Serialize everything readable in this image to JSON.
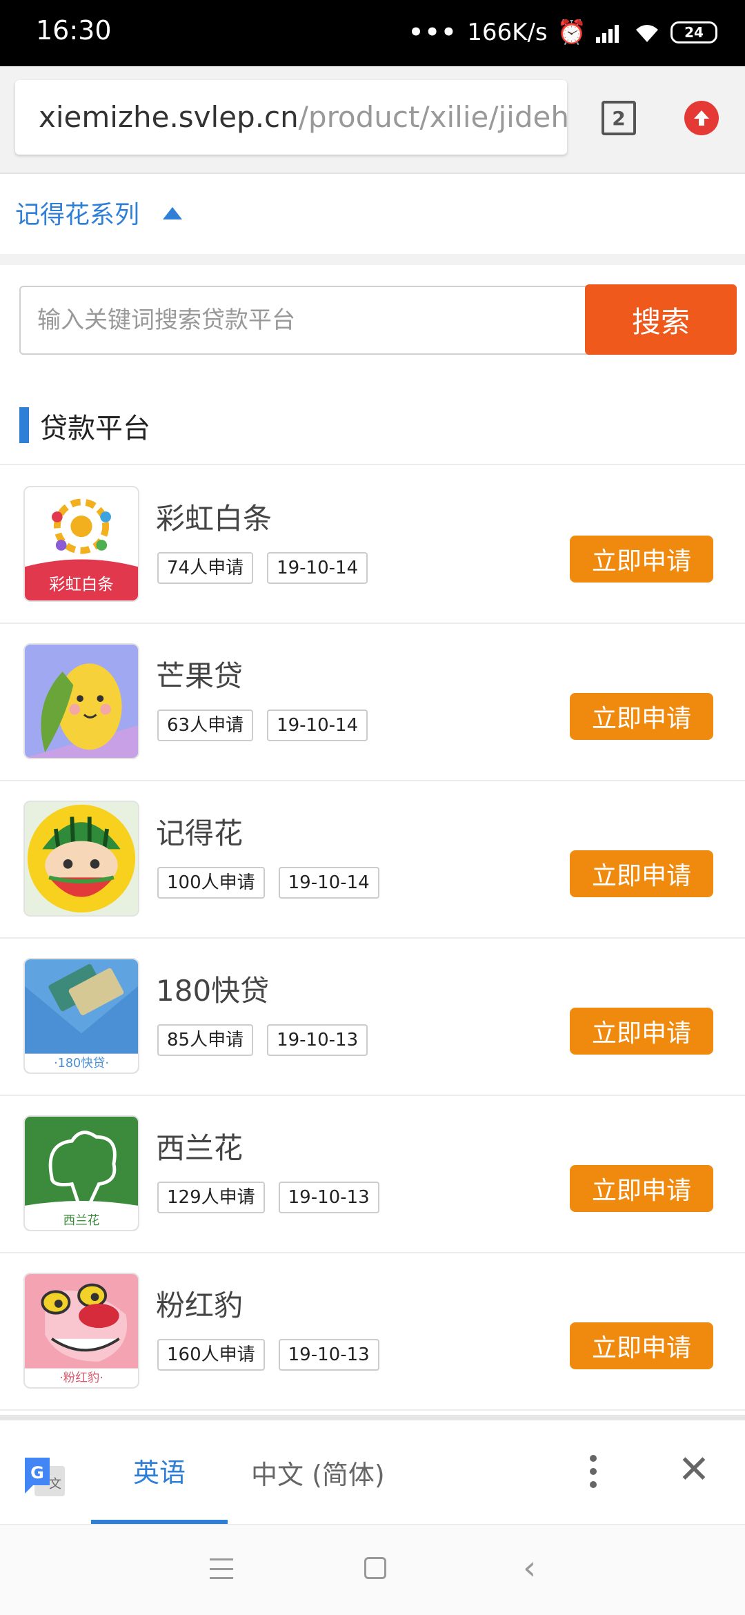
{
  "status_bar": {
    "time": "16:30",
    "network_speed": "166K/s",
    "battery": "24",
    "icons": [
      "more-dots-icon",
      "alarm-icon",
      "signal-icon",
      "wifi-icon",
      "battery-icon"
    ]
  },
  "browser": {
    "url_host": "xiemizhe.svlep.cn",
    "url_path": "/product/xilie/jidehu",
    "tab_count": "2"
  },
  "category": {
    "title": "记得花系列"
  },
  "search": {
    "placeholder": "输入关键词搜索贷款平台",
    "button_label": "搜索"
  },
  "section": {
    "title": "贷款平台"
  },
  "products": [
    {
      "name": "彩虹白条",
      "applicants": "74人申请",
      "date": "19-10-14",
      "button": "立即申请",
      "logo": "caihong-baitiao-logo"
    },
    {
      "name": "芒果贷",
      "applicants": "63人申请",
      "date": "19-10-14",
      "button": "立即申请",
      "logo": "mango-dai-logo"
    },
    {
      "name": "记得花",
      "applicants": "100人申请",
      "date": "19-10-14",
      "button": "立即申请",
      "logo": "jidehua-logo"
    },
    {
      "name": "180快贷",
      "applicants": "85人申请",
      "date": "19-10-13",
      "button": "立即申请",
      "logo": "180-kuaidai-logo"
    },
    {
      "name": "西兰花",
      "applicants": "129人申请",
      "date": "19-10-13",
      "button": "立即申请",
      "logo": "xilanhua-logo"
    },
    {
      "name": "粉红豹",
      "applicants": "160人申请",
      "date": "19-10-13",
      "button": "立即申请",
      "logo": "pink-panther-logo"
    }
  ],
  "logo_text": {
    "caihong": "彩虹白条",
    "kuaidai": "·180快贷·",
    "xilanhua": "西兰花",
    "fenhongbao": "·粉红豹·"
  },
  "translate_bar": {
    "lang_active": "英语",
    "lang_other": "中文 (简体)"
  },
  "colors": {
    "accent_blue": "#2f7fd6",
    "search_orange": "#ef5a1c",
    "apply_orange": "#f08a0f"
  }
}
